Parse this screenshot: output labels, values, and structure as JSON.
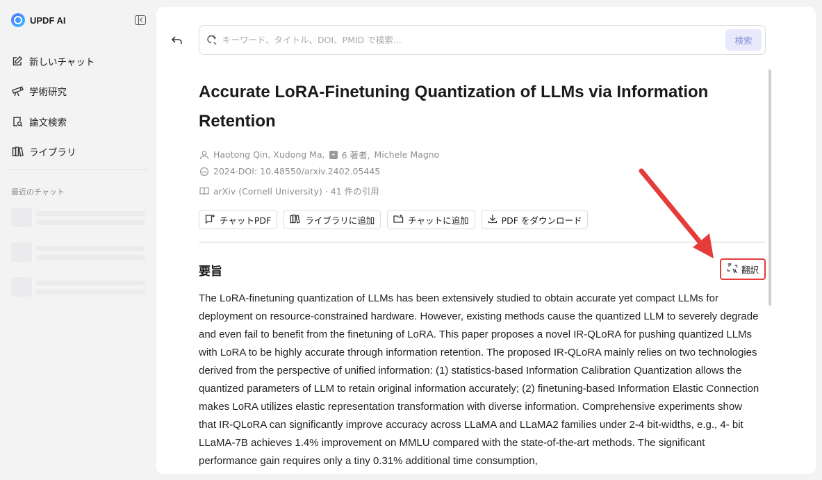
{
  "sidebar": {
    "brand": "UPDF AI",
    "nav": [
      {
        "label": "新しいチャット",
        "icon": "edit-icon"
      },
      {
        "label": "学術研究",
        "icon": "telescope-icon"
      },
      {
        "label": "論文検索",
        "icon": "doc-search-icon"
      },
      {
        "label": "ライブラリ",
        "icon": "library-icon"
      }
    ],
    "recent_label": "最近のチャット"
  },
  "search": {
    "placeholder": "キーワード、タイトル、DOI、PMID で検索...",
    "button": "検索"
  },
  "paper": {
    "title": "Accurate LoRA-Finetuning Quantization of LLMs via Information Retention",
    "authors": "Haotong Qin, Xudong Ma,",
    "more_authors": "6 著者,",
    "last_author": "Michele Magno",
    "date_doi": "2024·DOI: 10.48550/arxiv.2402.05445",
    "source": "arXiv (Cornell University) · 41 件の引用"
  },
  "actions": {
    "chat_pdf": "チャットPDF",
    "add_library": "ライブラリに追加",
    "add_chat": "チャットに追加",
    "download_pdf": "PDF をダウンロード"
  },
  "abstract": {
    "heading": "要旨",
    "translate": "翻訳",
    "text": "The LoRA-finetuning quantization of LLMs has been extensively studied to obtain accurate yet compact LLMs for deployment on resource-constrained hardware. However, existing methods cause the quantized LLM to severely degrade and even fail to benefit from the finetuning of LoRA. This paper proposes a novel IR-QLoRA for pushing quantized LLMs with LoRA to be highly accurate through information retention. The proposed IR-QLoRA mainly relies on two technologies derived from the perspective of unified information: (1) statistics-based Information Calibration Quantization allows the quantized parameters of LLM to retain original information accurately; (2) finetuning-based Information Elastic Connection makes LoRA utilizes elastic representation transformation with diverse information. Comprehensive experiments show that IR-QLoRA can significantly improve accuracy across LLaMA and LLaMA2 families under 2-4 bit-widths, e.g., 4- bit LLaMA-7B achieves 1.4% improvement on MMLU compared with the state-of-the-art methods. The significant performance gain requires only a tiny 0.31% additional time consumption,"
  },
  "colors": {
    "accent_red": "#e53b3b",
    "search_button_bg": "#e8e9fb",
    "search_button_text": "#8c8fd8"
  }
}
